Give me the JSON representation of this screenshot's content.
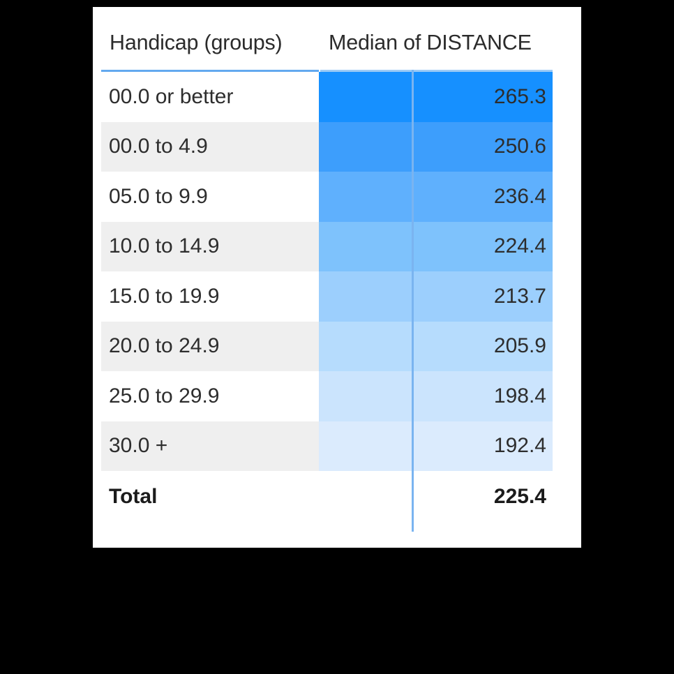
{
  "card": {
    "background": "#ffffff"
  },
  "table": {
    "name": "pivot-table",
    "columns": [
      {
        "key": "handicap_group",
        "label": "Handicap (groups)",
        "align": "left"
      },
      {
        "key": "median_distance",
        "label": "Median of DISTANCE",
        "align": "right"
      }
    ],
    "rows": [
      {
        "label": "00.0 or better",
        "value": "265.3",
        "fill": "#1690ff",
        "stripe": "#ffffff"
      },
      {
        "label": "00.0 to 4.9",
        "value": "250.6",
        "fill": "#3d9efc",
        "stripe": "#efefef"
      },
      {
        "label": "05.0 to 9.9",
        "value": "236.4",
        "fill": "#5fb0fd",
        "stripe": "#ffffff"
      },
      {
        "label": "10.0 to 14.9",
        "value": "224.4",
        "fill": "#7ec2fc",
        "stripe": "#efefef"
      },
      {
        "label": "15.0 to 19.9",
        "value": "213.7",
        "fill": "#9ccffd",
        "stripe": "#ffffff"
      },
      {
        "label": "20.0 to 24.9",
        "value": "205.9",
        "fill": "#b6dcfd",
        "stripe": "#efefef"
      },
      {
        "label": "25.0 to 29.9",
        "value": "198.4",
        "fill": "#cbe4fd",
        "stripe": "#ffffff"
      },
      {
        "label": "30.0 +",
        "value": "192.4",
        "fill": "#dbebfd",
        "stripe": "#efefef"
      }
    ],
    "total": {
      "label": "Total",
      "value": "225.4"
    }
  },
  "colors": {
    "accent": "#1690ff",
    "divider": "#7ab4f0",
    "header_rule_left": "#63a9ef",
    "header_rule_right": "#9ecbf5",
    "stripe": "#efefef",
    "page_background": "#000000",
    "card_background": "#ffffff",
    "text": "#2d2d2d"
  },
  "chart_data": {
    "type": "table",
    "title": "Median of DISTANCE by Handicap (groups)",
    "xlabel": "Handicap (groups)",
    "ylabel": "Median of DISTANCE",
    "categories": [
      "00.0 or better",
      "00.0 to 4.9",
      "05.0 to 9.9",
      "10.0 to 14.9",
      "15.0 to 19.9",
      "20.0 to 24.9",
      "25.0 to 29.9",
      "30.0 +"
    ],
    "values": [
      265.3,
      250.6,
      236.4,
      224.4,
      213.7,
      205.9,
      198.4,
      192.4
    ],
    "total": 225.4,
    "value_format": "0.0",
    "encoding": "heatmap-background (blue sequential, darkest = highest value)",
    "heatmap_colors": [
      "#1690ff",
      "#3d9efc",
      "#5fb0fd",
      "#7ec2fc",
      "#9ccffd",
      "#b6dcfd",
      "#cbe4fd",
      "#dbebfd"
    ],
    "legend": null,
    "grid": false
  }
}
